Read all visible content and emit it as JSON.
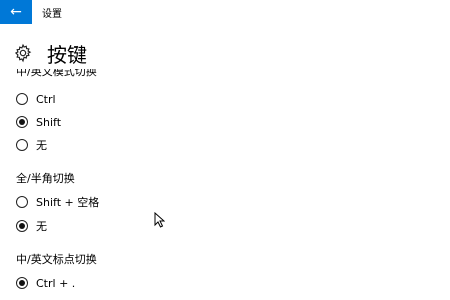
{
  "window": {
    "title": "设置",
    "back_icon": "←",
    "accent": "#0078d7"
  },
  "header": {
    "title": "按键",
    "icon": "gear-icon"
  },
  "groups": [
    {
      "label": "中/英文模式切换",
      "options": [
        {
          "label": "Ctrl",
          "selected": false
        },
        {
          "label": "Shift",
          "selected": true
        },
        {
          "label": "无",
          "selected": false
        }
      ]
    },
    {
      "label": "全/半角切换",
      "options": [
        {
          "label": "Shift + 空格",
          "selected": false
        },
        {
          "label": "无",
          "selected": true
        }
      ]
    },
    {
      "label": "中/英文标点切换",
      "options": [
        {
          "label": "Ctrl + .",
          "selected": true
        }
      ]
    }
  ]
}
